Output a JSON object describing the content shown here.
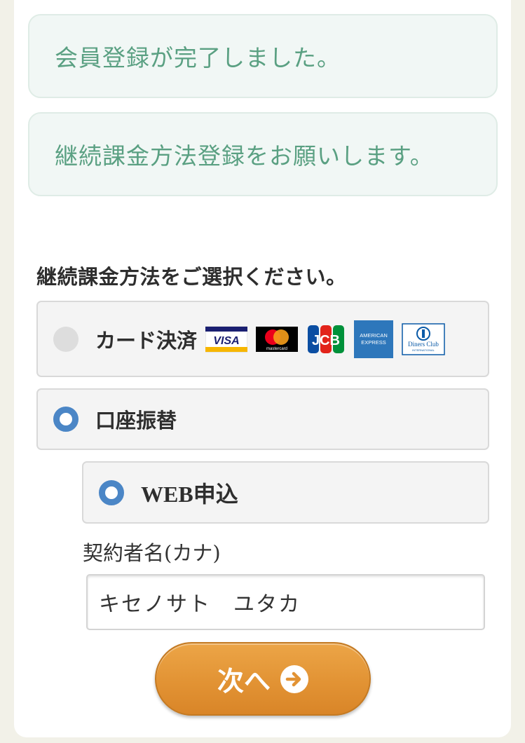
{
  "notices": {
    "registration_complete": "会員登録が完了しました。",
    "billing_request": "継続課金方法登録をお願いします。"
  },
  "billing": {
    "section_title": "継続課金方法をご選択ください。",
    "options": [
      {
        "label": "カード決済",
        "selected": false
      },
      {
        "label": "口座振替",
        "selected": true
      }
    ],
    "sub_option": {
      "label": "WEB申込",
      "selected": true
    },
    "card_brands": [
      "VISA",
      "mastercard",
      "JCB",
      "AMERICAN EXPRESS",
      "Diners Club INTERNATIONAL"
    ]
  },
  "form": {
    "name_label": "契約者名(カナ)",
    "name_value": "キセノサト　ユタカ"
  },
  "next_button": {
    "label": "次へ"
  },
  "colors": {
    "accent_blue": "#4b86c6",
    "notice_text": "#5aa082",
    "button_orange": "#e29334"
  }
}
